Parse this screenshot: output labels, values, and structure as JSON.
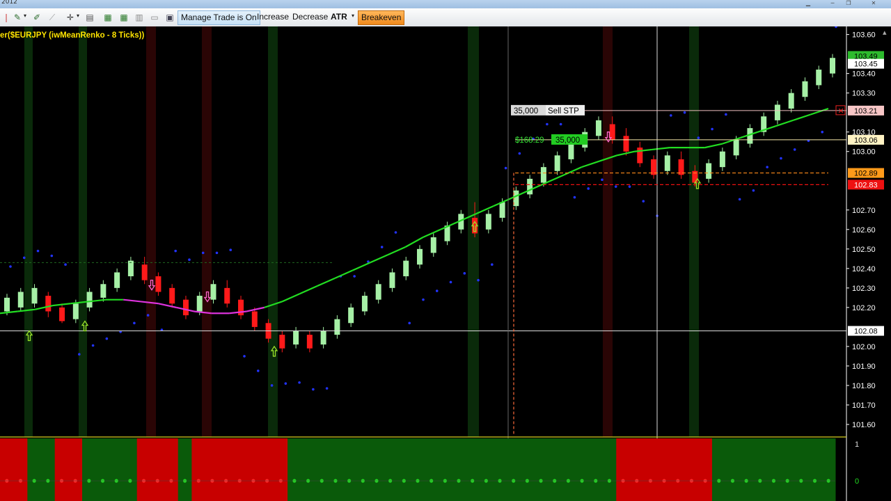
{
  "window": {
    "title_fragment": "2012"
  },
  "toolbar": {
    "manage_label": "Manage Trade is On",
    "increase_label": "Increase",
    "decrease_label": "Decrease",
    "atr_label": "ATR",
    "breakeven_label": "Breakeven"
  },
  "colors": {
    "bull": "#a6f0a6",
    "bear": "#ff1a1a",
    "ma_up": "#22dd22",
    "ma_down": "#dd33dd",
    "sar": "#2233ff",
    "axis": "#ffffff"
  },
  "chart_data": {
    "type": "candlestick",
    "title": "er($EURJPY (iwMeanRenko - 8 Ticks))",
    "instrument": "$EURJPY",
    "ylim": [
      101.55,
      103.62
    ],
    "y_ticks": [
      "103.60",
      "103.40",
      "103.30",
      "103.10",
      "103.00",
      "102.70",
      "102.60",
      "102.50",
      "102.40",
      "102.30",
      "102.20",
      "102.00",
      "101.90",
      "101.80",
      "101.70",
      "101.60"
    ],
    "y_tick_values": [
      103.6,
      103.4,
      103.3,
      103.1,
      103.0,
      102.7,
      102.6,
      102.5,
      102.4,
      102.3,
      102.2,
      102.0,
      101.9,
      101.8,
      101.7,
      101.6
    ],
    "price_tags": [
      {
        "label": "103.49",
        "value": 103.49,
        "color": "#2dbb2d",
        "text_color": "#000"
      },
      {
        "label": "103.45",
        "value": 103.45,
        "color": "#ffffff",
        "text_color": "#000"
      },
      {
        "label": "103.21",
        "value": 103.21,
        "color": "#f7c6c6",
        "text_color": "#000"
      },
      {
        "label": "103.06",
        "value": 103.06,
        "color": "#fff3c4",
        "text_color": "#000"
      },
      {
        "label": "102.89",
        "value": 102.89,
        "color": "#ff9a1a",
        "text_color": "#000"
      },
      {
        "label": "102.83",
        "value": 102.83,
        "color": "#ee1111",
        "text_color": "#fff"
      },
      {
        "label": "102.08",
        "value": 102.08,
        "color": "#ffffff",
        "text_color": "#000"
      }
    ],
    "orders": {
      "sell_stop": {
        "qty": "35,000",
        "label": "Sell STP",
        "price": 103.21
      },
      "position": {
        "pnl": "$168.29",
        "qty": "35,000",
        "price": 103.06
      },
      "target_line": 102.89,
      "stop_line": 102.83
    },
    "crosshair_price": 102.08,
    "candles": [
      [
        102.18,
        102.25,
        102.16,
        102.27
      ],
      [
        102.2,
        102.28,
        102.18,
        102.3
      ],
      [
        102.22,
        102.3,
        102.2,
        102.32
      ],
      [
        102.26,
        102.18,
        102.15,
        102.28
      ],
      [
        102.2,
        102.13,
        102.12,
        102.22
      ],
      [
        102.14,
        102.22,
        102.12,
        102.24
      ],
      [
        102.2,
        102.28,
        102.18,
        102.3
      ],
      [
        102.25,
        102.32,
        102.23,
        102.34
      ],
      [
        102.3,
        102.38,
        102.28,
        102.4
      ],
      [
        102.36,
        102.44,
        102.34,
        102.46
      ],
      [
        102.42,
        102.34,
        102.32,
        102.46
      ],
      [
        102.36,
        102.28,
        102.26,
        102.38
      ],
      [
        102.3,
        102.22,
        102.2,
        102.32
      ],
      [
        102.24,
        102.16,
        102.14,
        102.26
      ],
      [
        102.18,
        102.26,
        102.16,
        102.28
      ],
      [
        102.24,
        102.32,
        102.22,
        102.34
      ],
      [
        102.3,
        102.22,
        102.2,
        102.34
      ],
      [
        102.24,
        102.16,
        102.14,
        102.26
      ],
      [
        102.18,
        102.1,
        102.08,
        102.2
      ],
      [
        102.12,
        102.04,
        102.02,
        102.14
      ],
      [
        102.06,
        101.99,
        101.97,
        102.08
      ],
      [
        102.01,
        102.08,
        101.99,
        102.1
      ],
      [
        102.06,
        101.99,
        101.97,
        102.08
      ],
      [
        102.01,
        102.08,
        101.99,
        102.1
      ],
      [
        102.06,
        102.14,
        102.04,
        102.16
      ],
      [
        102.12,
        102.2,
        102.1,
        102.22
      ],
      [
        102.18,
        102.26,
        102.16,
        102.28
      ],
      [
        102.24,
        102.32,
        102.22,
        102.34
      ],
      [
        102.3,
        102.38,
        102.28,
        102.4
      ],
      [
        102.36,
        102.44,
        102.34,
        102.46
      ],
      [
        102.42,
        102.5,
        102.4,
        102.52
      ],
      [
        102.48,
        102.56,
        102.46,
        102.58
      ],
      [
        102.54,
        102.62,
        102.52,
        102.64
      ],
      [
        102.6,
        102.68,
        102.58,
        102.7
      ],
      [
        102.66,
        102.58,
        102.56,
        102.74
      ],
      [
        102.6,
        102.68,
        102.58,
        102.7
      ],
      [
        102.66,
        102.74,
        102.64,
        102.76
      ],
      [
        102.72,
        102.8,
        102.7,
        102.82
      ],
      [
        102.78,
        102.86,
        102.76,
        102.88
      ],
      [
        102.84,
        102.92,
        102.82,
        102.94
      ],
      [
        102.9,
        102.98,
        102.88,
        103.0
      ],
      [
        102.96,
        103.04,
        102.94,
        103.06
      ],
      [
        103.02,
        103.1,
        103.0,
        103.12
      ],
      [
        103.08,
        103.16,
        103.06,
        103.18
      ],
      [
        103.14,
        103.06,
        103.04,
        103.18
      ],
      [
        103.08,
        103.0,
        102.98,
        103.12
      ],
      [
        103.02,
        102.94,
        102.92,
        103.05
      ],
      [
        102.96,
        102.88,
        102.86,
        102.98
      ],
      [
        102.9,
        102.98,
        102.88,
        103.0
      ],
      [
        102.96,
        102.88,
        102.86,
        103.0
      ],
      [
        102.9,
        102.84,
        102.82,
        102.93
      ],
      [
        102.86,
        102.94,
        102.84,
        102.96
      ],
      [
        102.92,
        103.0,
        102.9,
        103.02
      ],
      [
        102.98,
        103.06,
        102.96,
        103.08
      ],
      [
        103.04,
        103.12,
        103.02,
        103.14
      ],
      [
        103.1,
        103.18,
        103.08,
        103.2
      ],
      [
        103.16,
        103.24,
        103.14,
        103.26
      ],
      [
        103.22,
        103.3,
        103.2,
        103.32
      ],
      [
        103.28,
        103.36,
        103.26,
        103.38
      ],
      [
        103.34,
        103.42,
        103.32,
        103.44
      ],
      [
        103.4,
        103.48,
        103.38,
        103.5
      ]
    ],
    "ma": [
      102.17,
      102.18,
      102.19,
      102.21,
      102.22,
      102.23,
      102.24,
      102.24,
      102.23,
      102.22,
      102.2,
      102.18,
      102.17,
      102.17,
      102.18,
      102.2,
      102.23,
      102.27,
      102.31,
      102.35,
      102.39,
      102.43,
      102.47,
      102.51,
      102.56,
      102.6,
      102.64,
      102.68,
      102.72,
      102.76,
      102.8,
      102.84,
      102.88,
      102.92,
      102.95,
      102.98,
      103.0,
      103.01,
      103.02,
      103.02,
      103.02,
      103.04,
      103.07,
      103.1,
      103.13,
      103.16,
      103.19,
      103.22
    ],
    "histogram": [
      "r",
      "r",
      "g",
      "g",
      "r",
      "r",
      "g",
      "g",
      "g",
      "g",
      "r",
      "r",
      "r",
      "g",
      "r",
      "r",
      "r",
      "r",
      "r",
      "r",
      "r",
      "g",
      "g",
      "g",
      "g",
      "g",
      "g",
      "g",
      "g",
      "g",
      "g",
      "g",
      "g",
      "g",
      "g",
      "g",
      "g",
      "g",
      "g",
      "g",
      "g",
      "g",
      "g",
      "g",
      "g",
      "r",
      "r",
      "r",
      "r",
      "r",
      "r",
      "r",
      "g",
      "g",
      "g",
      "g",
      "g",
      "g",
      "g",
      "g",
      "g"
    ],
    "panel_labels": [
      "1",
      "0"
    ]
  }
}
